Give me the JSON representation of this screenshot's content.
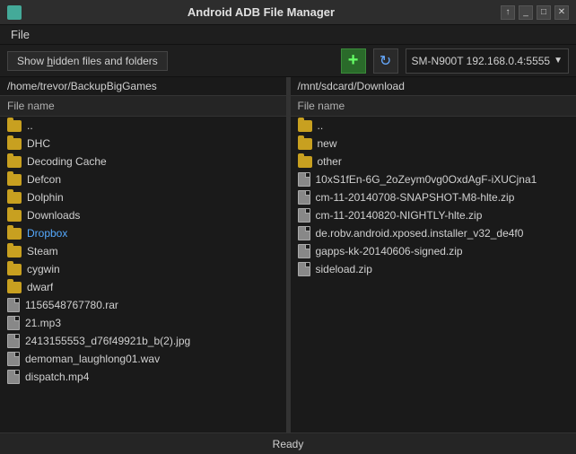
{
  "app": {
    "title": "Android ADB File Manager",
    "icon": "android-icon"
  },
  "titlebar": {
    "title": "Android ADB File Manager",
    "up_btn": "↑",
    "minimize_btn": "_",
    "maximize_btn": "□",
    "close_btn": "✕"
  },
  "menubar": {
    "items": [
      {
        "label": "File"
      }
    ]
  },
  "toolbar": {
    "show_hidden_label": "Show hidden files and folders",
    "add_label": "+",
    "refresh_label": "↻",
    "device_label": "SM-N900T 192.168.0.4:5555"
  },
  "left_panel": {
    "path": "/home/trevor/BackupBigGames",
    "header": "File name",
    "files": [
      {
        "type": "folder",
        "name": ".."
      },
      {
        "type": "folder",
        "name": "DHC"
      },
      {
        "type": "folder",
        "name": "Decoding Cache"
      },
      {
        "type": "folder",
        "name": "Defcon"
      },
      {
        "type": "folder",
        "name": "Dolphin"
      },
      {
        "type": "folder",
        "name": "Downloads"
      },
      {
        "type": "folder",
        "name": "Dropbox",
        "color": "blue"
      },
      {
        "type": "folder",
        "name": "Steam"
      },
      {
        "type": "folder",
        "name": "cygwin"
      },
      {
        "type": "folder",
        "name": "dwarf"
      },
      {
        "type": "file",
        "name": "1156548767780.rar"
      },
      {
        "type": "file",
        "name": "21.mp3"
      },
      {
        "type": "file",
        "name": "2413155553_d76f49921b_b(2).jpg"
      },
      {
        "type": "file",
        "name": "demoman_laughlong01.wav"
      },
      {
        "type": "file",
        "name": "dispatch.mp4"
      }
    ]
  },
  "right_panel": {
    "path": "/mnt/sdcard/Download",
    "header": "File name",
    "files": [
      {
        "type": "folder",
        "name": ".."
      },
      {
        "type": "folder",
        "name": "new"
      },
      {
        "type": "folder",
        "name": "other"
      },
      {
        "type": "file",
        "name": "10xS1fEn-6G_2oZeym0vg0OxdAgF-iXUCjna1"
      },
      {
        "type": "file",
        "name": "cm-11-20140708-SNAPSHOT-M8-hlte.zip"
      },
      {
        "type": "file",
        "name": "cm-11-20140820-NIGHTLY-hlte.zip"
      },
      {
        "type": "file",
        "name": "de.robv.android.xposed.installer_v32_de4f0"
      },
      {
        "type": "file",
        "name": "gapps-kk-20140606-signed.zip"
      },
      {
        "type": "file",
        "name": "sideload.zip"
      }
    ]
  },
  "statusbar": {
    "text": "Ready"
  }
}
